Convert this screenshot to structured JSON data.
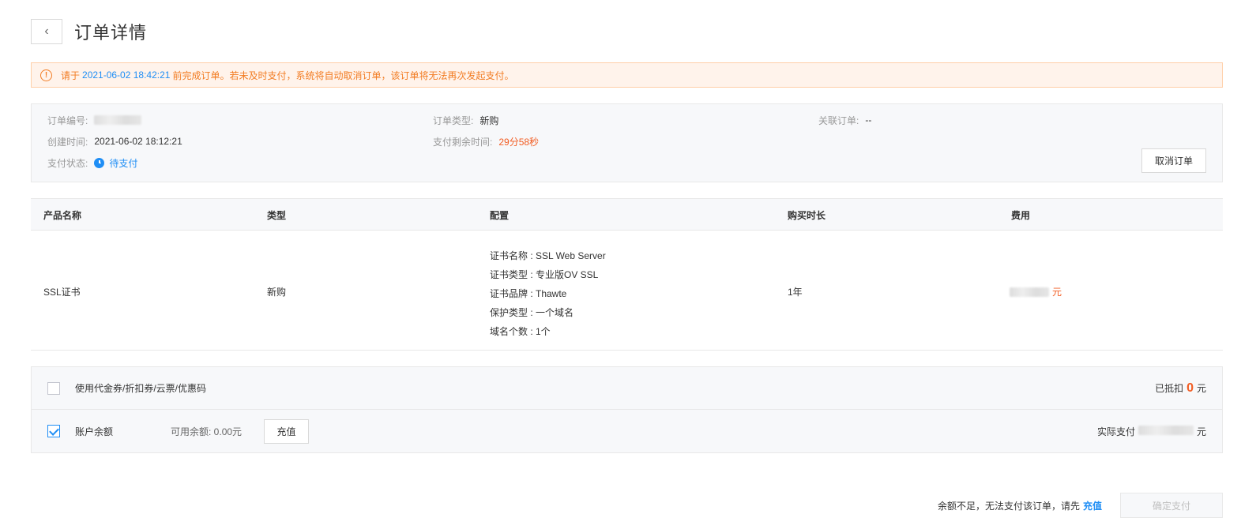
{
  "header": {
    "back_icon": "‹",
    "title": "订单详情"
  },
  "notice": {
    "icon": "!",
    "prefix": "请于",
    "deadline": "2021-06-02 18:42:21",
    "suffix": "前完成订单。若未及时支付，系统将自动取消订单，该订单将无法再次发起支付。"
  },
  "order_info": {
    "order_no_label": "订单编号:",
    "created_label": "创建时间:",
    "created_value": "2021-06-02 18:12:21",
    "status_label": "支付状态:",
    "status_value": "待支付",
    "type_label": "订单类型:",
    "type_value": "新购",
    "remaining_label": "支付剩余时间:",
    "remaining_value": "29分58秒",
    "related_label": "关联订单:",
    "related_value": "--",
    "cancel_label": "取消订单"
  },
  "table": {
    "headers": [
      "产品名称",
      "类型",
      "配置",
      "购买时长",
      "费用"
    ],
    "row": {
      "product": "SSL证书",
      "type": "新购",
      "config": [
        "证书名称 : SSL Web Server",
        "证书类型 : 专业版OV SSL",
        "证书品牌 : Thawte",
        "保护类型 : 一个域名",
        "域名个数 : 1个"
      ],
      "duration": "1年",
      "cost_unit": "元"
    }
  },
  "payment": {
    "coupon_label": "使用代金券/折扣券/云票/优惠码",
    "deducted_prefix": "已抵扣",
    "deducted_value": "0",
    "deducted_unit": "元",
    "balance_label": "账户余额",
    "available_label": "可用余额: 0.00元",
    "recharge_label": "充值",
    "actual_prefix": "实际支付",
    "actual_unit": "元"
  },
  "footer": {
    "message": "余额不足，无法支付该订单，请先",
    "link": "充值",
    "confirm_label": "确定支付"
  },
  "colors": {
    "accent": "#1f8ef5",
    "warning": "#f27c23",
    "price": "#f25d23"
  }
}
